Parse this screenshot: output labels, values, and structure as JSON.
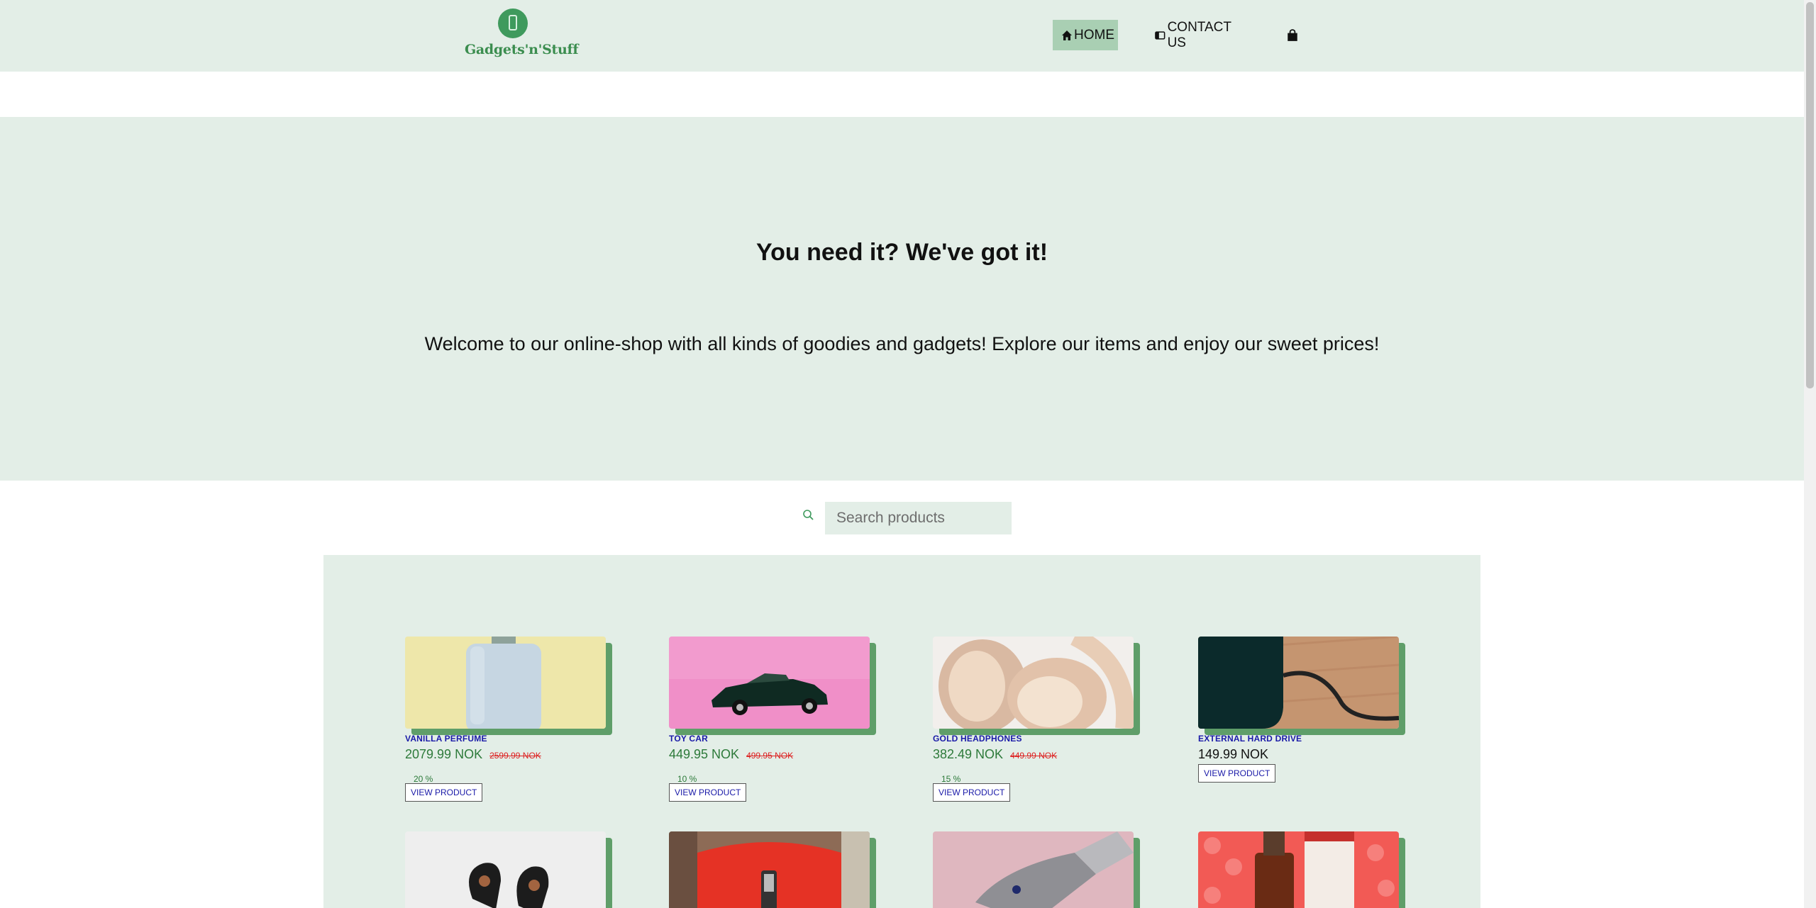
{
  "brand": {
    "name": "Gadgets'n'Stuff"
  },
  "nav": {
    "home_label": "HOME",
    "contact_label": "CONTACT US"
  },
  "hero": {
    "title": "You need it? We've got it!",
    "subtitle": "Welcome to our online-shop with all kinds of goodies and gadgets! Explore our items and enjoy our sweet prices!"
  },
  "search": {
    "placeholder": "Search products"
  },
  "products": [
    {
      "name": "VANILLA PERFUME",
      "price": "2079.99 NOK",
      "old_price": "2599.99 NOK",
      "discount": "20 %",
      "button": "VIEW PRODUCT"
    },
    {
      "name": "TOY CAR",
      "price": "449.95 NOK",
      "old_price": "499.95 NOK",
      "discount": "10 %",
      "button": "VIEW PRODUCT"
    },
    {
      "name": "GOLD HEADPHONES",
      "price": "382.49 NOK",
      "old_price": "449.99 NOK",
      "discount": "15 %",
      "button": "VIEW PRODUCT"
    },
    {
      "name": "EXTERNAL HARD DRIVE",
      "price": "149.99 NOK",
      "button": "VIEW PRODUCT"
    }
  ],
  "colors": {
    "mint_background": "#e3eee7",
    "nav_active": "#a9cfb3",
    "brand_green": "#3f9a5d",
    "card_shadow": "#5f9e69",
    "product_name": "#1a1aa8",
    "sale_price": "#2d7a3a",
    "old_price": "#dd2222"
  },
  "icons": {
    "home": "home-icon",
    "contact": "contact-card-icon",
    "cart": "shopping-bag-icon",
    "search": "search-icon"
  }
}
